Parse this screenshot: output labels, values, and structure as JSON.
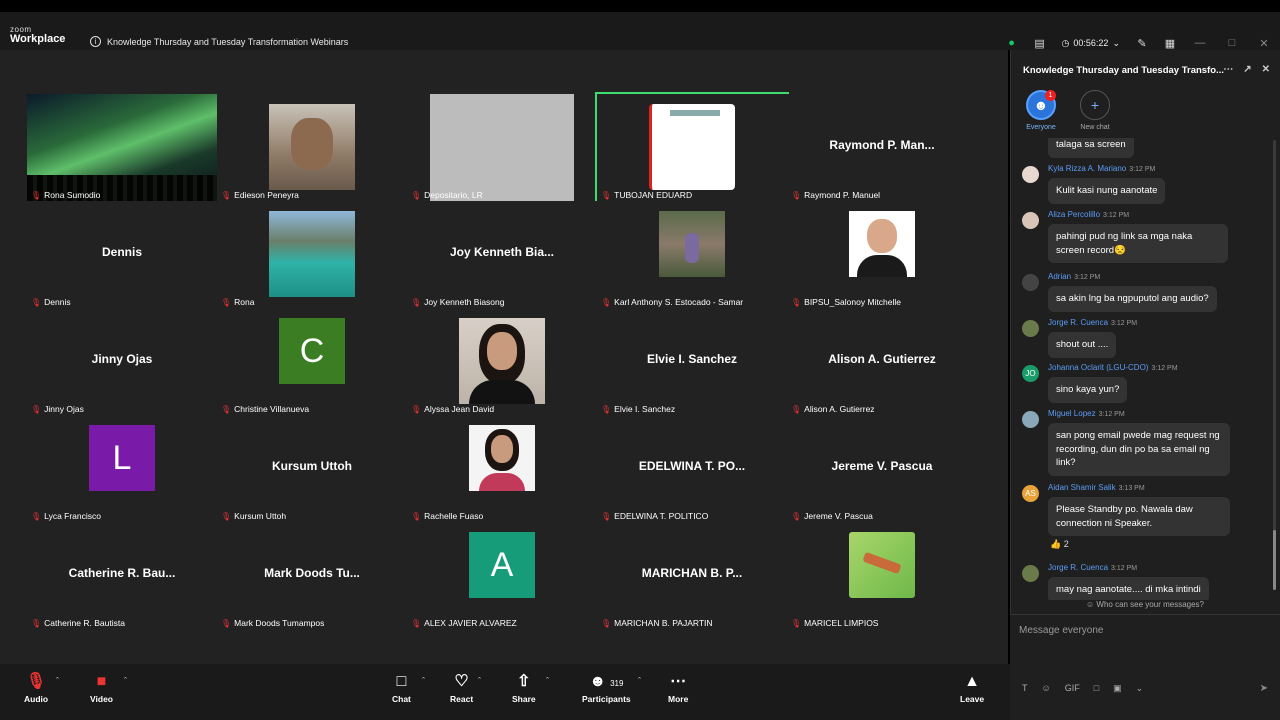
{
  "app": {
    "logo_small": "zoom",
    "logo_big": "Workplace"
  },
  "meeting": {
    "title": "Knowledge Thursday and Tuesday Transformation Webinars",
    "timer": "00:56:22"
  },
  "tiles": [
    {
      "label": "Rona Sumodio",
      "center": "",
      "kind": "aurora"
    },
    {
      "label": "Edieson Peneyra",
      "center": "",
      "kind": "face",
      "color": "#8a7a6a"
    },
    {
      "label": "Depositario, LR",
      "center": "",
      "kind": "gray"
    },
    {
      "label": "TUBOJAN EDUARD",
      "center": "",
      "kind": "doc"
    },
    {
      "label": "Raymond P. Manuel",
      "center": "Raymond P. Man...",
      "kind": "name"
    },
    {
      "label": "Dennis",
      "center": "Dennis",
      "kind": "name"
    },
    {
      "label": "Rona",
      "center": "",
      "kind": "lake"
    },
    {
      "label": "Joy Kenneth Biasong",
      "center": "Joy Kenneth Bia...",
      "kind": "name"
    },
    {
      "label": "Karl Anthony S. Estocado - Samar",
      "center": "",
      "kind": "outdoor"
    },
    {
      "label": "BIPSU_Salonoy Mitchelle",
      "center": "",
      "kind": "portrait"
    },
    {
      "label": "Jinny Ojas",
      "center": "Jinny Ojas",
      "kind": "name"
    },
    {
      "label": "Christine Villanueva",
      "center": "",
      "kind": "letter",
      "letter": "C",
      "color": "#3a7d22"
    },
    {
      "label": "Alyssa Jean David",
      "center": "",
      "kind": "portrait2"
    },
    {
      "label": "Elvie I. Sanchez",
      "center": "Elvie I. Sanchez",
      "kind": "name"
    },
    {
      "label": "Alison A. Gutierrez",
      "center": "Alison A. Gutierrez",
      "kind": "name"
    },
    {
      "label": "Lyca Francisco",
      "center": "",
      "kind": "letter",
      "letter": "L",
      "color": "#7a1aa8"
    },
    {
      "label": "Kursum Uttoh",
      "center": "Kursum Uttoh",
      "kind": "name"
    },
    {
      "label": "Rachelle Fuaso",
      "center": "",
      "kind": "portrait3"
    },
    {
      "label": "EDELWINA T. POLITICO",
      "center": "EDELWINA T. PO...",
      "kind": "name"
    },
    {
      "label": "Jereme V. Pascua",
      "center": "Jereme V. Pascua",
      "kind": "name"
    },
    {
      "label": "Catherine R. Bautista",
      "center": "Catherine R. Bau...",
      "kind": "name"
    },
    {
      "label": "Mark Doods Tumampos",
      "center": "Mark Doods Tu...",
      "kind": "name"
    },
    {
      "label": "ALEX JAVIER ALVAREZ",
      "center": "",
      "kind": "letter",
      "letter": "A",
      "color": "#169c78"
    },
    {
      "label": "MARICHAN B. PAJARTIN",
      "center": "MARICHAN B. P...",
      "kind": "name"
    },
    {
      "label": "MARICEL LIMPIOS",
      "center": "",
      "kind": "field"
    }
  ],
  "chat": {
    "title": "Knowledge Thursday and Tuesday Transfo...",
    "tab_everyone": "Everyone",
    "tab_new": "New chat",
    "badge": "1",
    "top_fragment": "talaga sa screen",
    "messages": [
      {
        "name": "Kyla Rizza A. Mariano",
        "time": "3:12 PM",
        "text": "Kulit kasi nung aanotate",
        "av": "photo"
      },
      {
        "name": "Aliza Percolillo",
        "time": "3:12 PM",
        "text": "pahingi pud ng link sa mga naka screen record😒",
        "av": "photo"
      },
      {
        "name": "Adrian",
        "time": "3:12 PM",
        "text": "sa akin lng ba ngpuputol ang audio?",
        "av": "photo"
      },
      {
        "name": "Jorge R. Cuenca",
        "time": "3:12 PM",
        "text": "shout out ....",
        "av": "photo"
      },
      {
        "name": "Johanna Oclarit (LGU-CDO)",
        "time": "3:12 PM",
        "text": "sino kaya yun?",
        "av": "JO"
      },
      {
        "name": "Miguel Lopez",
        "time": "3:12 PM",
        "text": "san pong email pwede mag request ng recording, dun din po ba sa email ng link?",
        "av": "photo"
      },
      {
        "name": "Aidan Shamir Salik",
        "time": "3:13 PM",
        "text": "Please Standby po. Nawala daw connection ni Speaker.",
        "av": "AS"
      },
      {
        "name": "Jorge R. Cuenca",
        "time": "3:12 PM",
        "text": "may nag aanotate.... di mka intindi",
        "av": "photo"
      }
    ],
    "reaction": "👍 2",
    "who_can_see": "Who can see your messages?",
    "compose_placeholder": "Message everyone"
  },
  "toolbar": {
    "audio": "Audio",
    "video": "Video",
    "chat": "Chat",
    "react": "React",
    "share": "Share",
    "participants": "Participants",
    "participants_count": "319",
    "more": "More",
    "leave": "Leave"
  }
}
